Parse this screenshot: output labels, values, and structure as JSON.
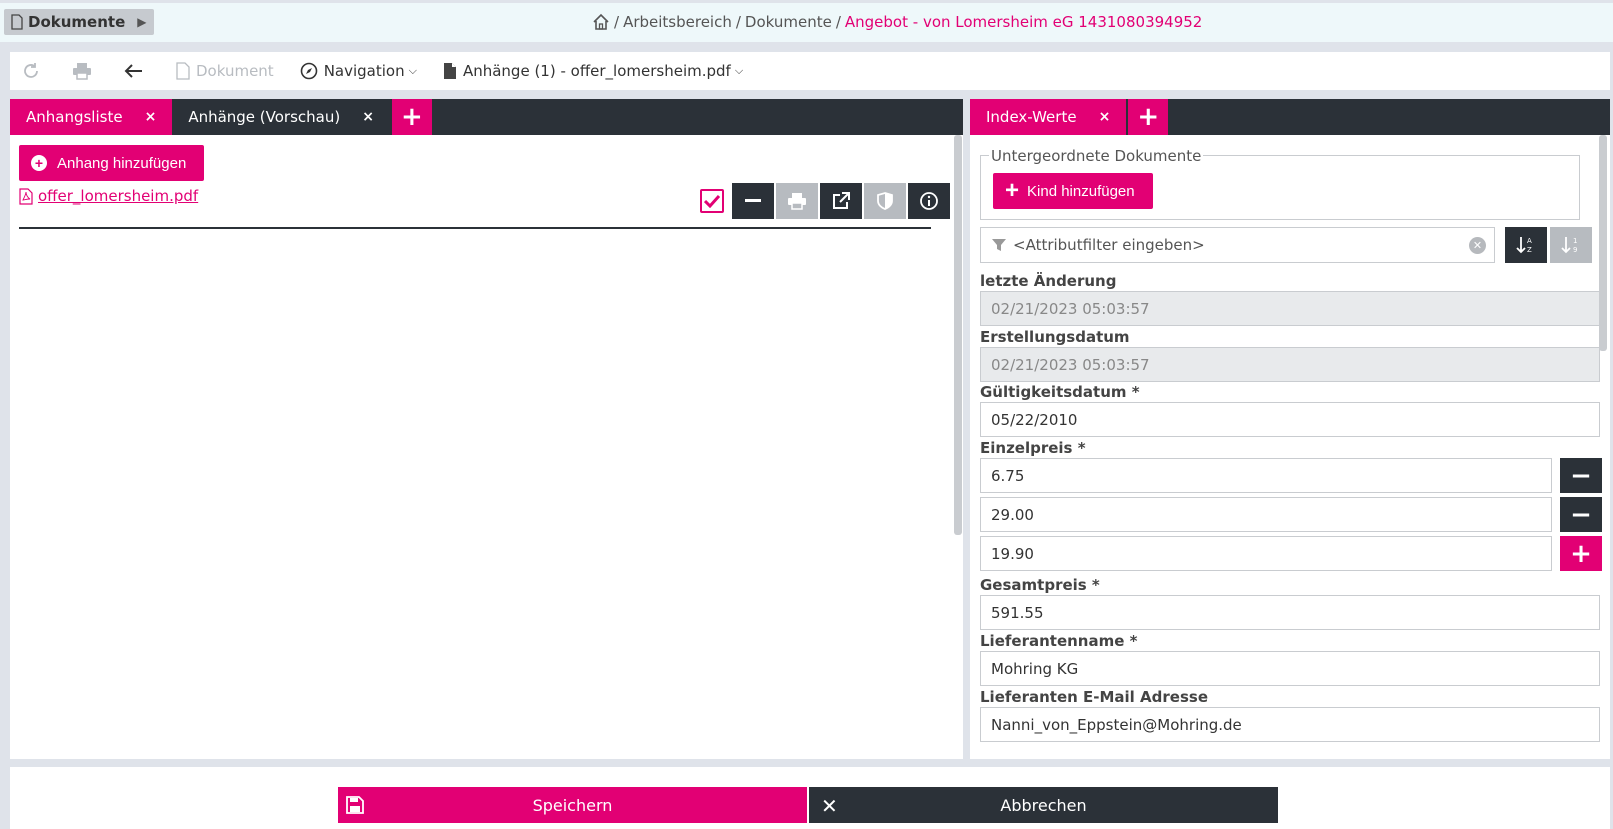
{
  "header": {
    "doc_button": "Dokumente",
    "breadcrumb_workspace": "Arbeitsbereich",
    "breadcrumb_docs": "Dokumente",
    "breadcrumb_sep": "/",
    "breadcrumb_current": "Angebot - von Lomersheim eG 1431080394952"
  },
  "toolbar": {
    "document_label": "Dokument",
    "navigation_label": "Navigation",
    "attachments_label": "Anhänge (1) - offer_lomersheim.pdf"
  },
  "left_tabs": [
    {
      "label": "Anhangsliste",
      "close": "×"
    },
    {
      "label": "Anhänge (Vorschau)",
      "close": "×"
    }
  ],
  "left": {
    "add_attachment": "Anhang hinzufügen",
    "file_name": "offer_lomersheim.pdf"
  },
  "right_tabs": [
    {
      "label": "Index-Werte",
      "close": "×"
    }
  ],
  "right": {
    "subdocs_legend": "Untergeordnete Dokumente",
    "add_child": "Kind hinzufügen",
    "filter_placeholder": "<Attributfilter eingeben>",
    "fields": {
      "last_change_label": "letzte Änderung",
      "last_change_value": "02/21/2023 05:03:57",
      "created_label": "Erstellungsdatum",
      "created_value": "02/21/2023 05:03:57",
      "valid_label": "Gültigkeitsdatum *",
      "valid_value": "05/22/2010",
      "unit_price_label": "Einzelpreis *",
      "unit_prices": [
        "6.75",
        "29.00",
        "19.90"
      ],
      "total_label": "Gesamtpreis *",
      "total_value": "591.55",
      "supplier_label": "Lieferantenname *",
      "supplier_value": "Mohring KG",
      "supplier_email_label": "Lieferanten E-Mail Adresse",
      "supplier_email_value": "Nanni_von_Eppstein@Mohring.de"
    }
  },
  "footer": {
    "save": "Speichern",
    "cancel": "Abbrechen"
  },
  "colors": {
    "accent": "#e20074",
    "dark": "#2b3138"
  }
}
